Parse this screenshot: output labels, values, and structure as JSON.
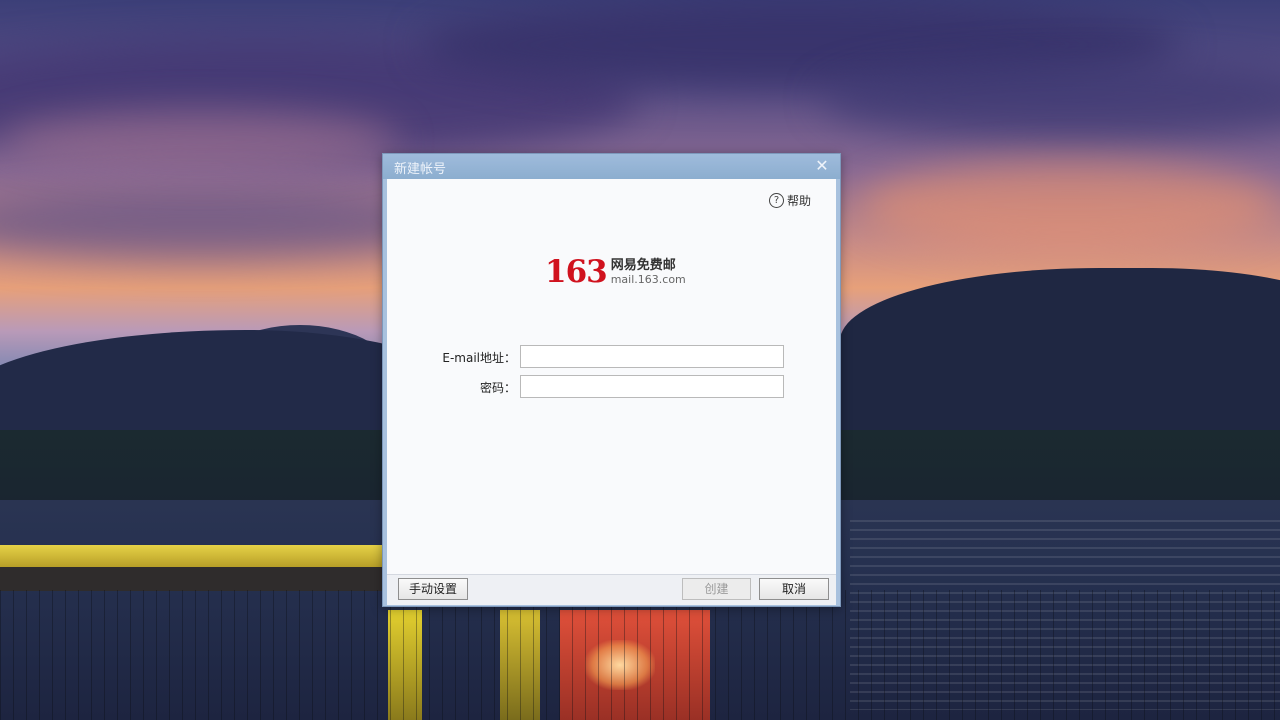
{
  "dialog": {
    "title": "新建帐号",
    "close_glyph": "✕",
    "help_label": "帮助",
    "help_glyph": "?"
  },
  "logo": {
    "number": "163",
    "name": "网易免费邮",
    "domain": "mail.163.com"
  },
  "form": {
    "email_label": "E-mail地址：",
    "email_value": "",
    "password_label": "密码：",
    "password_value": ""
  },
  "footer": {
    "manual_label": "手动设置",
    "create_label": "创建",
    "cancel_label": "取消"
  },
  "colors": {
    "brand_red": "#d0121e",
    "titlebar": "#8caecf"
  }
}
